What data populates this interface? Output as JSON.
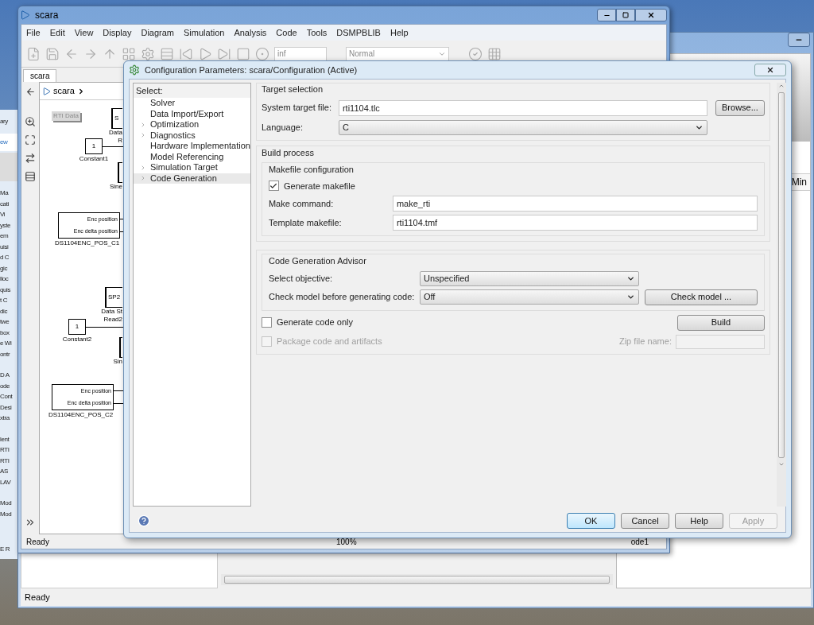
{
  "library_window": {
    "header_fragments": [
      "ary",
      "ew"
    ],
    "item_groups": [
      [
        "Ma",
        "cati",
        "Vi",
        "yste",
        "em",
        "uisi",
        "d C",
        "gic",
        "lloc",
        "quis",
        "t C",
        "dic",
        "twe",
        "box",
        "e Wi",
        "ontr"
      ],
      [
        "D A",
        "ode",
        "Cont",
        "Desi",
        "xtra"
      ],
      [
        "lent",
        "RTI",
        "RTI",
        "AS",
        "LAV"
      ],
      [
        "Mod",
        "Mod"
      ]
    ],
    "status": "E R"
  },
  "back_window": {
    "column_header": "Min",
    "status": "Ready"
  },
  "model_window": {
    "title": "scara",
    "menu": [
      "File",
      "Edit",
      "View",
      "Display",
      "Diagram",
      "Simulation",
      "Analysis",
      "Code",
      "Tools",
      "DSMPBLIB",
      "Help"
    ],
    "stop_time": "inf",
    "sim_mode": "Normal",
    "tab": "scara",
    "breadcrumb": "scara",
    "blocks": [
      {
        "kind": "annotation",
        "text": "RTI Data"
      },
      {
        "kind": "stub",
        "text": "S",
        "labels": [
          "Data",
          "R"
        ]
      },
      {
        "kind": "constant",
        "value": "1",
        "label": "Constant1"
      },
      {
        "kind": "stub",
        "labels": [
          "Sine"
        ]
      },
      {
        "kind": "encoder",
        "ports": [
          "Enc position",
          "Enc delta position"
        ],
        "label": "DS1104ENC_POS_C1"
      },
      {
        "kind": "stub",
        "text": "SP2",
        "labels": [
          "Data St",
          "Read2"
        ]
      },
      {
        "kind": "constant",
        "value": "1",
        "label": "Constant2"
      },
      {
        "kind": "stub",
        "labels": [
          "Sin"
        ]
      },
      {
        "kind": "encoder",
        "ports": [
          "Enc position",
          "Enc delta position"
        ],
        "label": "DS1104ENC_POS_C2"
      }
    ],
    "status": "Ready",
    "zoom": "100%",
    "solver": "ode1"
  },
  "dialog": {
    "title": "Configuration Parameters: scara/Configuration (Active)",
    "tree_heading": "Select:",
    "tree": [
      {
        "label": "Solver",
        "expandable": false,
        "selected": false
      },
      {
        "label": "Data Import/Export",
        "expandable": false,
        "selected": false
      },
      {
        "label": "Optimization",
        "expandable": true,
        "selected": false
      },
      {
        "label": "Diagnostics",
        "expandable": true,
        "selected": false
      },
      {
        "label": "Hardware Implementation",
        "expandable": false,
        "selected": false
      },
      {
        "label": "Model Referencing",
        "expandable": false,
        "selected": false
      },
      {
        "label": "Simulation Target",
        "expandable": true,
        "selected": false
      },
      {
        "label": "Code Generation",
        "expandable": true,
        "selected": true
      }
    ],
    "target_selection": {
      "heading": "Target selection",
      "system_target_file": {
        "label": "System target file:",
        "value": "rti1104.tlc"
      },
      "browse_button": "Browse...",
      "language": {
        "label": "Language:",
        "value": "C"
      }
    },
    "build_process": {
      "heading": "Build process",
      "makefile_heading": "Makefile configuration",
      "generate_makefile": {
        "label": "Generate makefile",
        "checked": true
      },
      "make_command": {
        "label": "Make command:",
        "value": "make_rti"
      },
      "template_makefile": {
        "label": "Template makefile:",
        "value": "rti1104.tmf"
      }
    },
    "advisor": {
      "heading": "Code Generation Advisor",
      "select_objective": {
        "label": "Select objective:",
        "value": "Unspecified"
      },
      "check_model": {
        "label": "Check model before generating code:",
        "value": "Off"
      },
      "check_model_button": "Check model ..."
    },
    "generate_code_only": {
      "label": "Generate code only",
      "checked": false,
      "disabled": false
    },
    "build_button": "Build",
    "package_code": {
      "label": "Package code and artifacts",
      "checked": false,
      "disabled": true
    },
    "zip_file": {
      "label": "Zip file name:",
      "disabled": true
    },
    "buttons": [
      {
        "label": "OK",
        "default": true,
        "disabled": false
      },
      {
        "label": "Cancel",
        "default": false,
        "disabled": false
      },
      {
        "label": "Help",
        "default": false,
        "disabled": false
      },
      {
        "label": "Apply",
        "default": false,
        "disabled": true
      }
    ]
  }
}
